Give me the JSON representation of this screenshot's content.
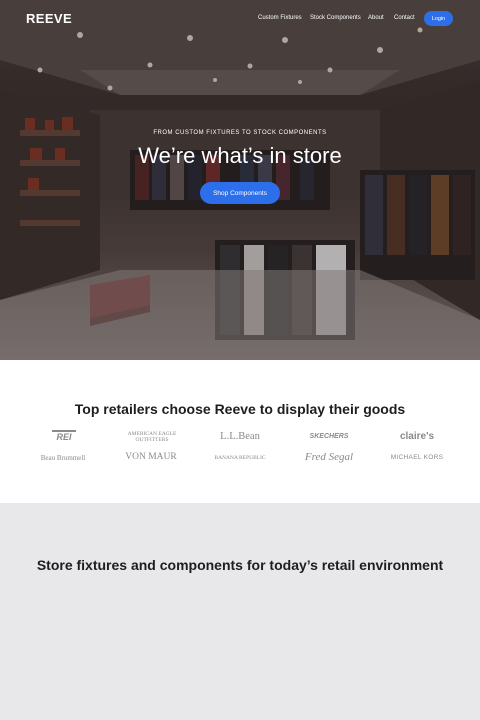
{
  "header": {
    "logo": "REEVE",
    "nav": [
      "Custom Fixtures",
      "Stock Components",
      "About",
      "Contact"
    ],
    "login_label": "Login"
  },
  "hero": {
    "eyebrow": "FROM CUSTOM FIXTURES TO STOCK COMPONENTS",
    "title": "We’re what’s in store",
    "cta_label": "Shop Components"
  },
  "retailers": {
    "heading_pre": "Top retailers ",
    "heading_bold": "choose Reeve",
    "heading_post": " to display their goods",
    "logos": [
      "REI",
      "AMERICAN EAGLE OUTFITTERS",
      "L.L.Bean",
      "SKECHERS",
      "claire's",
      "Beau Brummell",
      "VON MAUR",
      "BANANA REPUBLIC",
      "Fred Segal",
      "MICHAEL KORS"
    ]
  },
  "fixtures": {
    "heading_pre": "Store fixtures and components for ",
    "heading_bold": "today’s retail environment"
  },
  "colors": {
    "accent": "#2d6fea",
    "light_section": "#e8e7ea",
    "text_dark": "#1e1e1e",
    "logo_gray": "#8a8a8a"
  }
}
